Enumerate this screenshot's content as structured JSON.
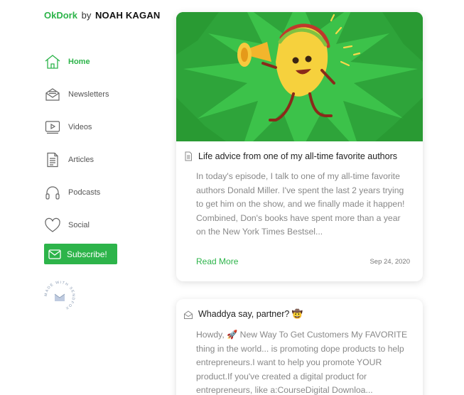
{
  "brand": {
    "name": "OkDork",
    "by": "by",
    "author": "NOAH KAGAN"
  },
  "nav": {
    "items": [
      {
        "label": "Home",
        "icon": "home-icon",
        "active": true
      },
      {
        "label": "Newsletters",
        "icon": "newsletter-icon"
      },
      {
        "label": "Videos",
        "icon": "video-icon"
      },
      {
        "label": "Articles",
        "icon": "article-icon"
      },
      {
        "label": "Podcasts",
        "icon": "headphones-icon"
      },
      {
        "label": "Social",
        "icon": "heart-icon"
      }
    ]
  },
  "subscribe": {
    "label": "Subscribe!",
    "icon": "mail-icon"
  },
  "badge": {
    "text": "MADE WITH SENDFOX",
    "icon": "sendfox-badge-icon"
  },
  "posts": [
    {
      "title": "Life advice from one of my all-time favorite authors",
      "excerpt": "In today's episode, I talk to one of my all-time favorite authors Donald Miller. I've spent the last 2 years trying to get him on the show, and we finally made it happen! Combined, Don's books have spent more than a year on the New York Times Bestsel...",
      "read_more": "Read More",
      "date": "Sep 24, 2020",
      "icon": "document-icon"
    },
    {
      "title": "Whaddya say, partner? 🤠",
      "excerpt": "Howdy, 🚀 New Way To Get Customers My FAVORITE thing in the world... is promoting dope products to help entrepreneurs.I want to help you promote YOUR product.If you've created a digital product for entrepreneurs, like a:CourseDigital Downloa...",
      "icon": "newsletter-icon"
    }
  ],
  "colors": {
    "accent": "#2db44a",
    "hero_bg": "#2ea43a"
  }
}
